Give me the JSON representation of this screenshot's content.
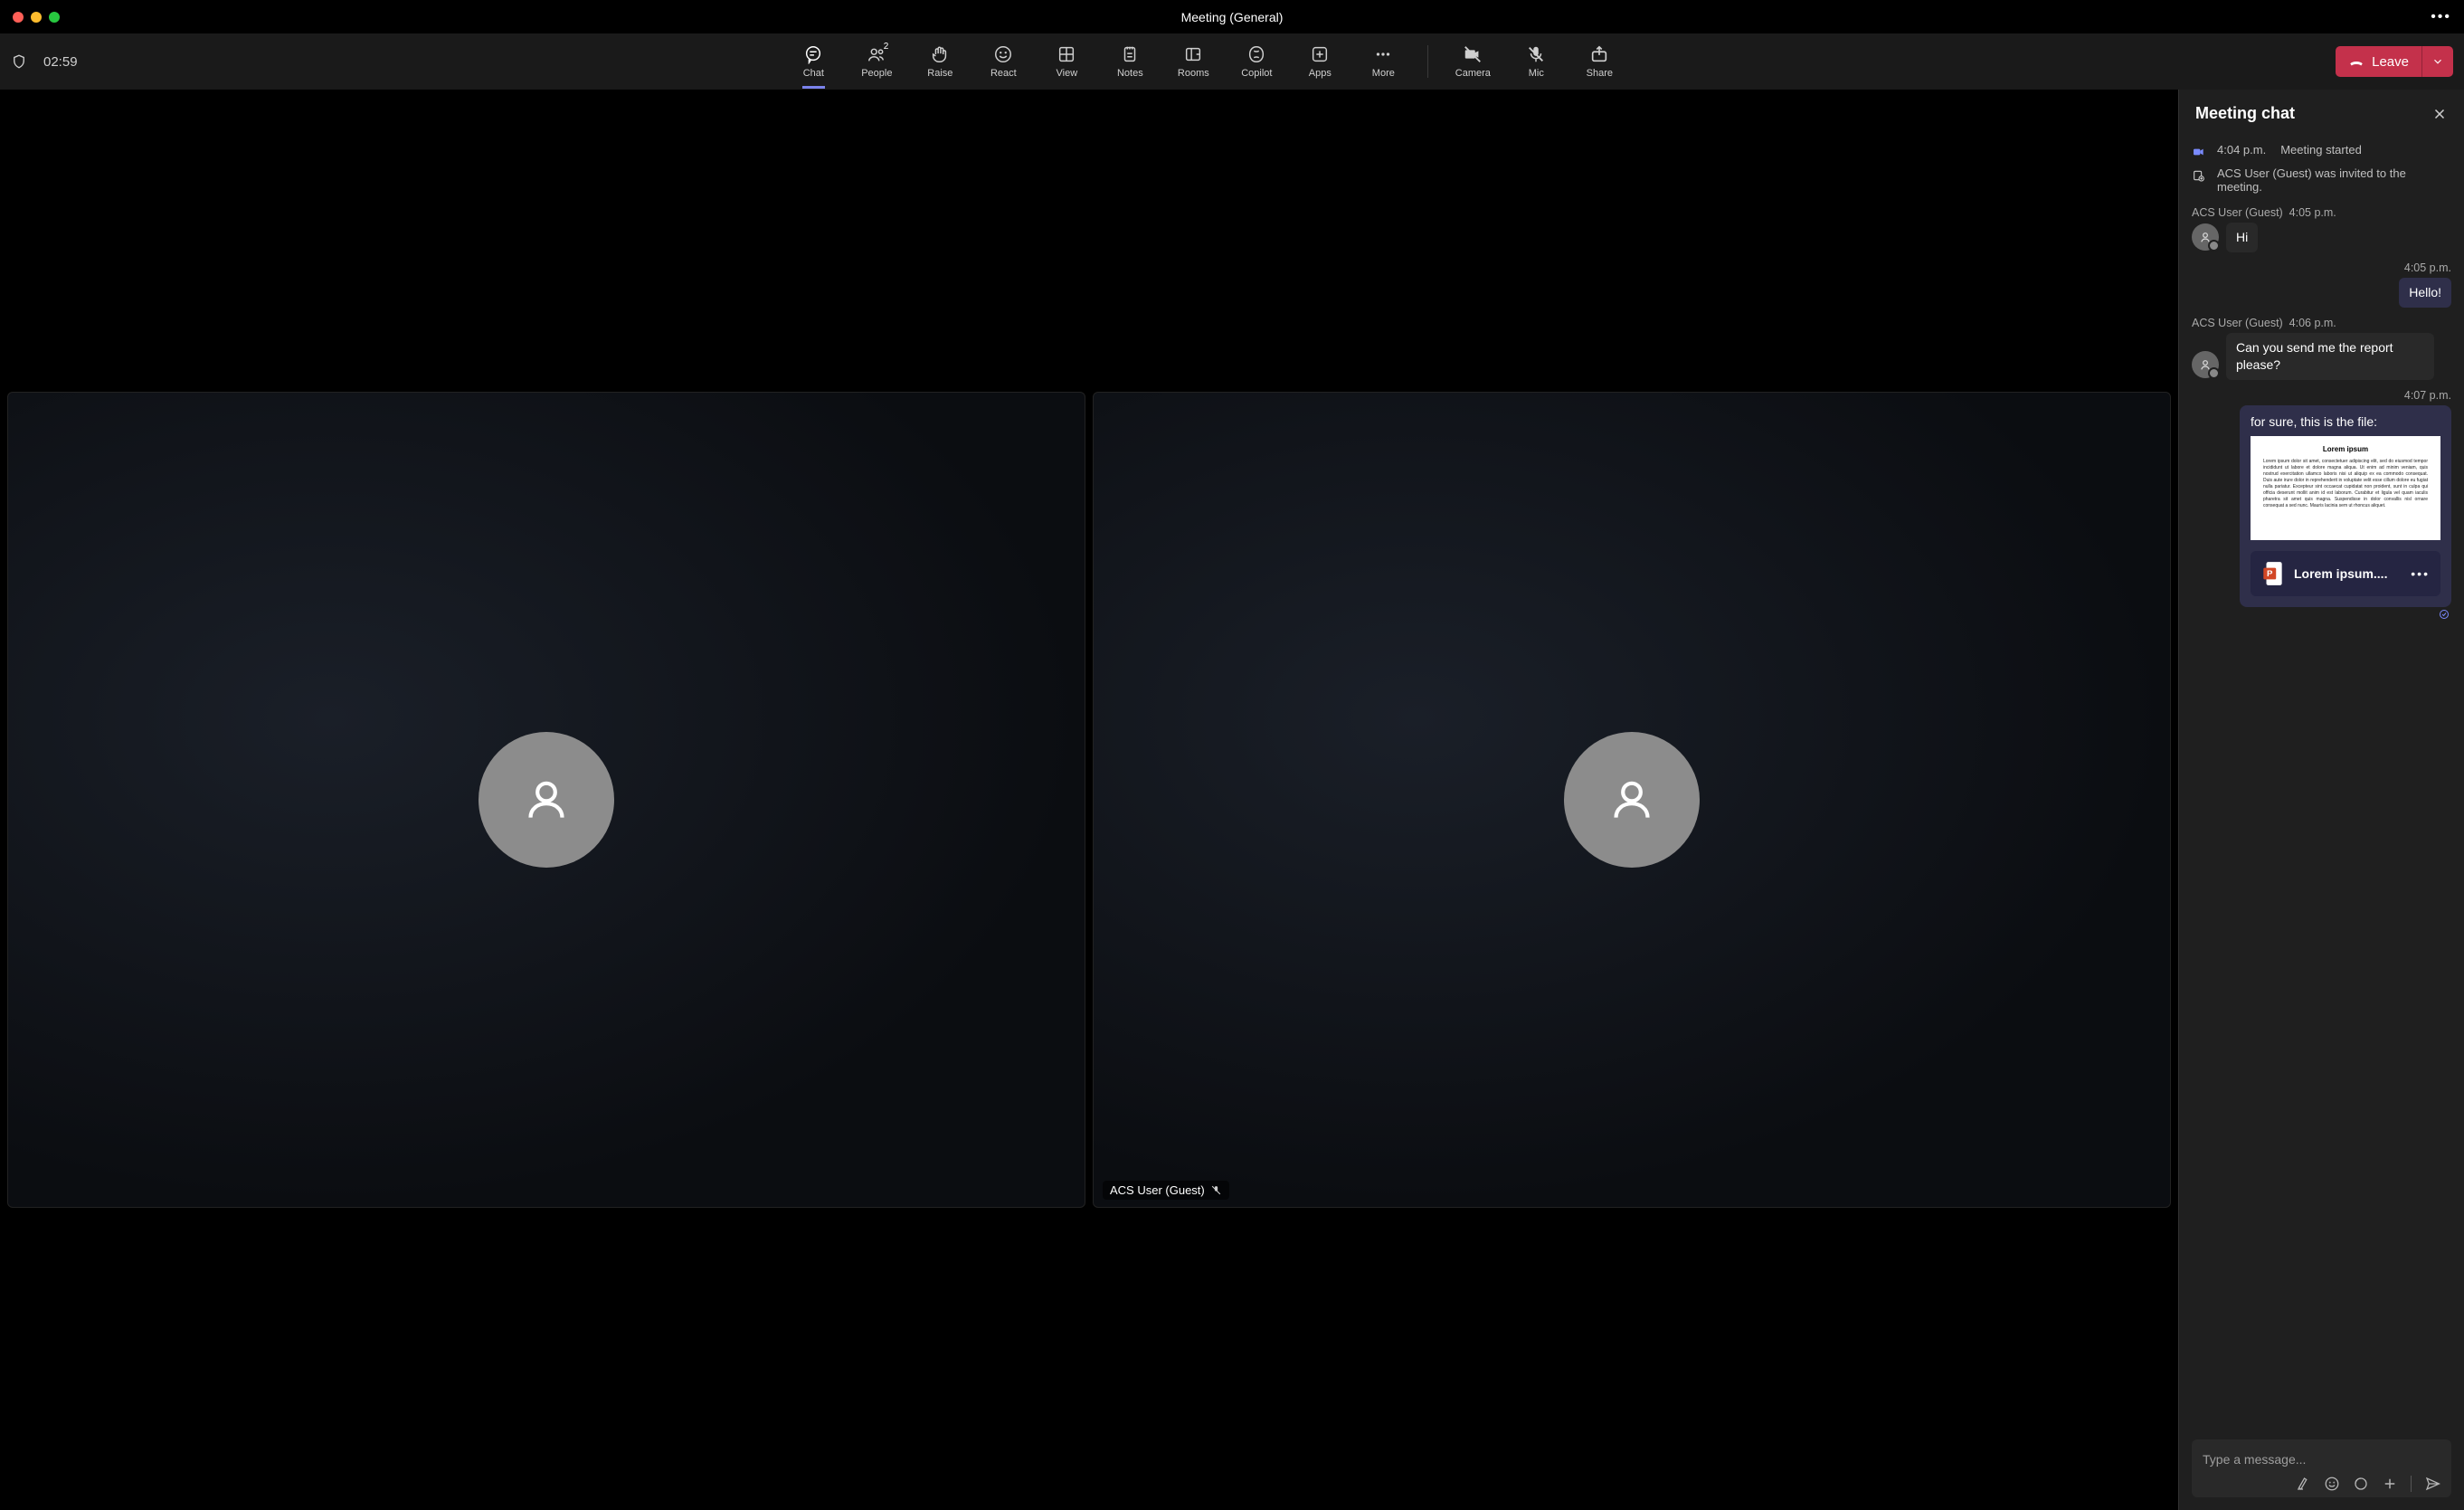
{
  "title": "Meeting (General)",
  "timer": "02:59",
  "toolbar": {
    "chat": "Chat",
    "people": "People",
    "people_count": "2",
    "raise": "Raise",
    "react": "React",
    "view": "View",
    "notes": "Notes",
    "rooms": "Rooms",
    "copilot": "Copilot",
    "apps": "Apps",
    "more": "More",
    "camera": "Camera",
    "mic": "Mic",
    "share": "Share",
    "leave": "Leave"
  },
  "participants": [
    {
      "name": ""
    },
    {
      "name": "ACS User (Guest)",
      "muted": true
    }
  ],
  "chat": {
    "title": "Meeting chat",
    "system": {
      "started_time": "4:04 p.m.",
      "started_text": "Meeting started",
      "invited_text": "ACS User (Guest) was invited to the meeting."
    },
    "messages": [
      {
        "author": "ACS User (Guest)",
        "time": "4:05 p.m.",
        "text": "Hi",
        "mine": false
      },
      {
        "time": "4:05 p.m.",
        "text": "Hello!",
        "mine": true
      },
      {
        "author": "ACS User (Guest)",
        "time": "4:06 p.m.",
        "text": "Can you send me the report please?",
        "mine": false
      },
      {
        "time": "4:07 p.m.",
        "text": "for sure, this is the file:",
        "mine": true,
        "attachment": {
          "preview_title": "Lorem ipsum",
          "filename": "Lorem ipsum...."
        }
      }
    ],
    "placeholder": "Type a message..."
  }
}
